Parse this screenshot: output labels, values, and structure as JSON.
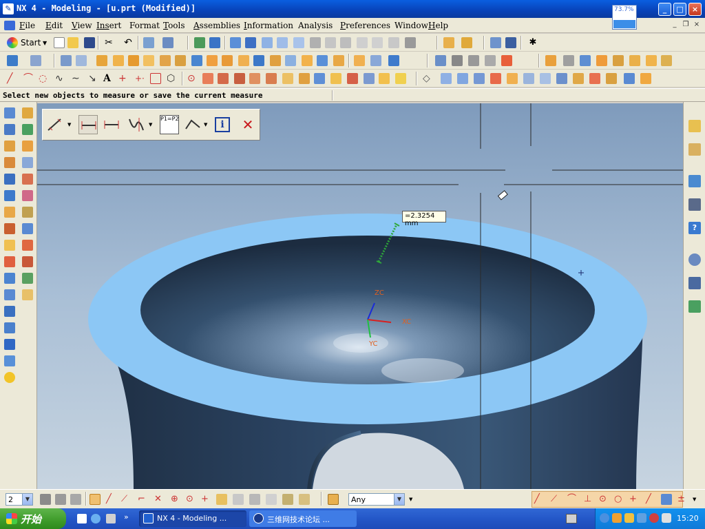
{
  "window": {
    "title": "NX 4 - Modeling - [u.prt (Modified)]",
    "cpu_meter": "73.7%",
    "buttons": {
      "minimize": "_",
      "maximize": "□",
      "close": "×"
    }
  },
  "menu": {
    "items": [
      {
        "label": "File",
        "u": "F",
        "rest": "ile"
      },
      {
        "label": "Edit",
        "u": "E",
        "rest": "dit"
      },
      {
        "label": "View",
        "u": "V",
        "rest": "iew"
      },
      {
        "label": "Insert",
        "u": "Ins",
        "rest": "ert"
      },
      {
        "label": "Format",
        "u": "",
        "rest": "Format"
      },
      {
        "label": "Tools",
        "u": "T",
        "rest": "ools"
      },
      {
        "label": "Assemblies",
        "u": "A",
        "rest": "ssemblies"
      },
      {
        "label": "Information",
        "u": "I",
        "rest": "nformation"
      },
      {
        "label": "Analysis",
        "u": "",
        "rest": "Analysis"
      },
      {
        "label": "Preferences",
        "u": "P",
        "rest": "references"
      },
      {
        "label": "Window",
        "u": "",
        "rest": "Window"
      },
      {
        "label": "Help",
        "u": "H",
        "rest": "elp"
      }
    ]
  },
  "toolbar": {
    "start_label": "Start"
  },
  "status": {
    "cue": "Select new objects to measure or save the current measure"
  },
  "measure_toolbar": {
    "info_label": "i",
    "close_label": "✕",
    "p1p2_label": "P1=P2"
  },
  "viewport": {
    "dimension_label": "=2.3254 mm",
    "axis_labels": {
      "zc": "ZC",
      "xc": "XC",
      "yc": "YC"
    }
  },
  "bottom_toolbar": {
    "layer_value": "2",
    "filter_value": "Any"
  },
  "taskbar": {
    "start_label": "开始",
    "tasks": [
      {
        "label": "NX 4 - Modeling ...",
        "active": true
      },
      {
        "label": "三维网技术论坛 ...",
        "active": false
      }
    ],
    "clock": "15:20"
  },
  "colors": {
    "title_bar": "#0842b8",
    "part_top_face": "#8cc7f5",
    "part_body": "#2a3f58",
    "measure_green": "#2fa83a",
    "close_red": "#c8181c"
  }
}
